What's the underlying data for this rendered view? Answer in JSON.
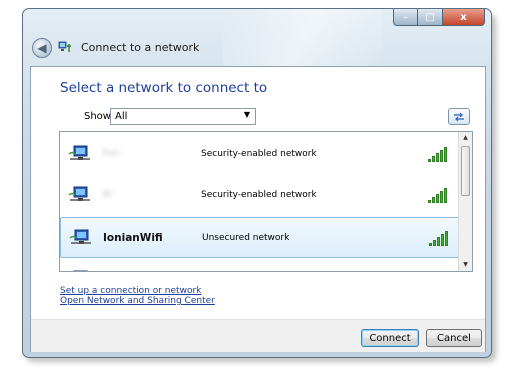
{
  "window": {
    "title": "Connect to a network",
    "caption_buttons": {
      "minimize": "–",
      "maximize": "□",
      "close": "x"
    },
    "back_glyph": "◀"
  },
  "main": {
    "heading": "Select a network to connect to",
    "show_label": "Show",
    "show_value": "All",
    "refresh_glyph": "↹"
  },
  "networks": [
    {
      "ssid": "Pan",
      "security": "Security-enabled network",
      "signal_bars": 5,
      "obscured": true,
      "selected": false,
      "icon": "wireless-network-icon"
    },
    {
      "ssid": "W",
      "security": "Security-enabled network",
      "signal_bars": 5,
      "obscured": true,
      "selected": false,
      "icon": "wireless-network-icon"
    },
    {
      "ssid": "IonianWifi",
      "security": "Unsecured network",
      "signal_bars": 5,
      "obscured": false,
      "selected": true,
      "icon": "wireless-network-icon"
    },
    {
      "ssid": "",
      "security": "",
      "signal_bars": 5,
      "obscured": true,
      "selected": false,
      "icon": "wireless-network-icon",
      "partial": true
    }
  ],
  "links": {
    "setup": "Set up a connection or network",
    "sharing_center": "Open Network and Sharing Center"
  },
  "buttons": {
    "connect": "Connect",
    "cancel": "Cancel"
  },
  "colors": {
    "accent_link": "#1e3f9e",
    "signal_green": "#47b233",
    "selection": "#dceefb"
  }
}
